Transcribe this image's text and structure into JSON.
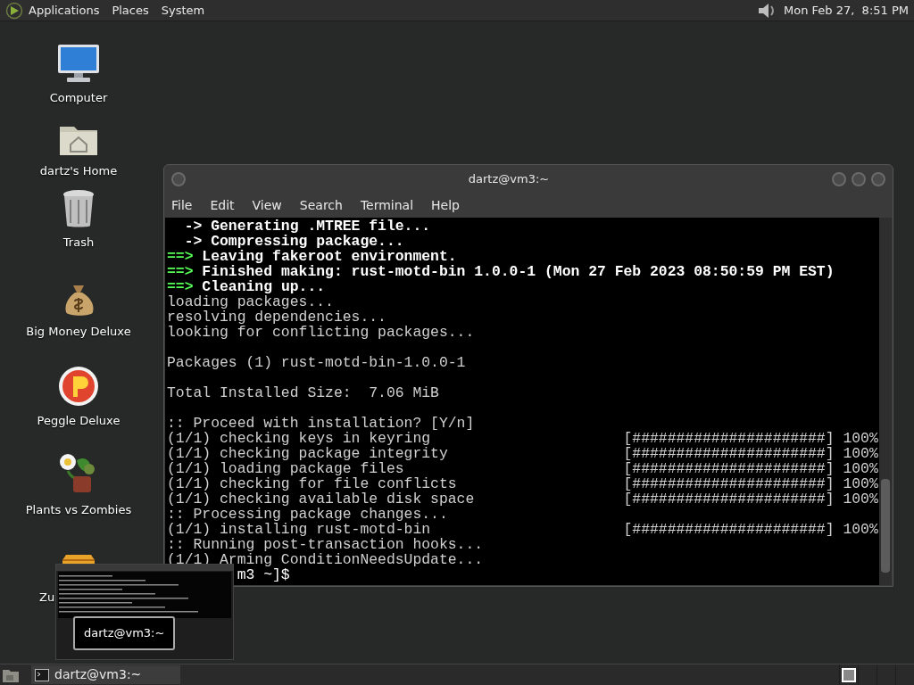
{
  "top_panel": {
    "menus": [
      "Applications",
      "Places",
      "System"
    ],
    "clock": "Mon Feb 27,  8:51 PM"
  },
  "desktop_icons": [
    {
      "kind": "computer",
      "label": "Computer"
    },
    {
      "kind": "home",
      "label": "dartz's Home"
    },
    {
      "kind": "trash",
      "label": "Trash"
    },
    {
      "kind": "moneybag",
      "label": "Big Money Deluxe"
    },
    {
      "kind": "peggle",
      "label": "Peggle Deluxe"
    },
    {
      "kind": "plant",
      "label": "Plants vs Zombies"
    },
    {
      "kind": "cube",
      "label": "Zu"
    }
  ],
  "terminal": {
    "title": "dartz@vm3:~",
    "menu": [
      "File",
      "Edit",
      "View",
      "Search",
      "Terminal",
      "Help"
    ],
    "lines": [
      {
        "kind": "sub",
        "prefix": "->",
        "text": "Generating .MTREE file..."
      },
      {
        "kind": "sub",
        "prefix": "->",
        "text": "Compressing package..."
      },
      {
        "kind": "step",
        "prefix": "==>",
        "text": "Leaving fakeroot environment."
      },
      {
        "kind": "step",
        "prefix": "==>",
        "text": "Finished making: rust-motd-bin 1.0.0-1 (Mon 27 Feb 2023 08:50:59 PM EST)"
      },
      {
        "kind": "step",
        "prefix": "==>",
        "text": "Cleaning up..."
      },
      {
        "kind": "plain",
        "text": "loading packages..."
      },
      {
        "kind": "plain",
        "text": "resolving dependencies..."
      },
      {
        "kind": "plain",
        "text": "looking for conflicting packages..."
      },
      {
        "kind": "blank"
      },
      {
        "kind": "plain",
        "text": "Packages (1) rust-motd-bin-1.0.0-1"
      },
      {
        "kind": "blank"
      },
      {
        "kind": "plain",
        "text": "Total Installed Size:  7.06 MiB"
      },
      {
        "kind": "blank"
      },
      {
        "kind": "plain",
        "text": ":: Proceed with installation? [Y/n]"
      },
      {
        "kind": "progress",
        "text": "(1/1) checking keys in keyring",
        "bar": "[######################]",
        "percent": "100%"
      },
      {
        "kind": "progress",
        "text": "(1/1) checking package integrity",
        "bar": "[######################]",
        "percent": "100%"
      },
      {
        "kind": "progress",
        "text": "(1/1) loading package files",
        "bar": "[######################]",
        "percent": "100%"
      },
      {
        "kind": "progress",
        "text": "(1/1) checking for file conflicts",
        "bar": "[######################]",
        "percent": "100%"
      },
      {
        "kind": "progress",
        "text": "(1/1) checking available disk space",
        "bar": "[######################]",
        "percent": "100%"
      },
      {
        "kind": "plain",
        "text": ":: Processing package changes..."
      },
      {
        "kind": "progress",
        "text": "(1/1) installing rust-motd-bin",
        "bar": "[######################]",
        "percent": "100%"
      },
      {
        "kind": "plain",
        "text": ":: Running post-transaction hooks..."
      },
      {
        "kind": "plain",
        "text": "(1/1) Arming ConditionNeedsUpdate..."
      },
      {
        "kind": "prompt",
        "text": "m3 ~]$"
      }
    ]
  },
  "window_preview": {
    "label": "dartz@vm3:~"
  },
  "taskbar": {
    "tasks": [
      {
        "label": "dartz@vm3:~",
        "selected": false
      }
    ],
    "workspaces": [
      {
        "selected": true
      },
      {
        "selected": false
      },
      {
        "selected": false
      },
      {
        "selected": false
      }
    ]
  }
}
